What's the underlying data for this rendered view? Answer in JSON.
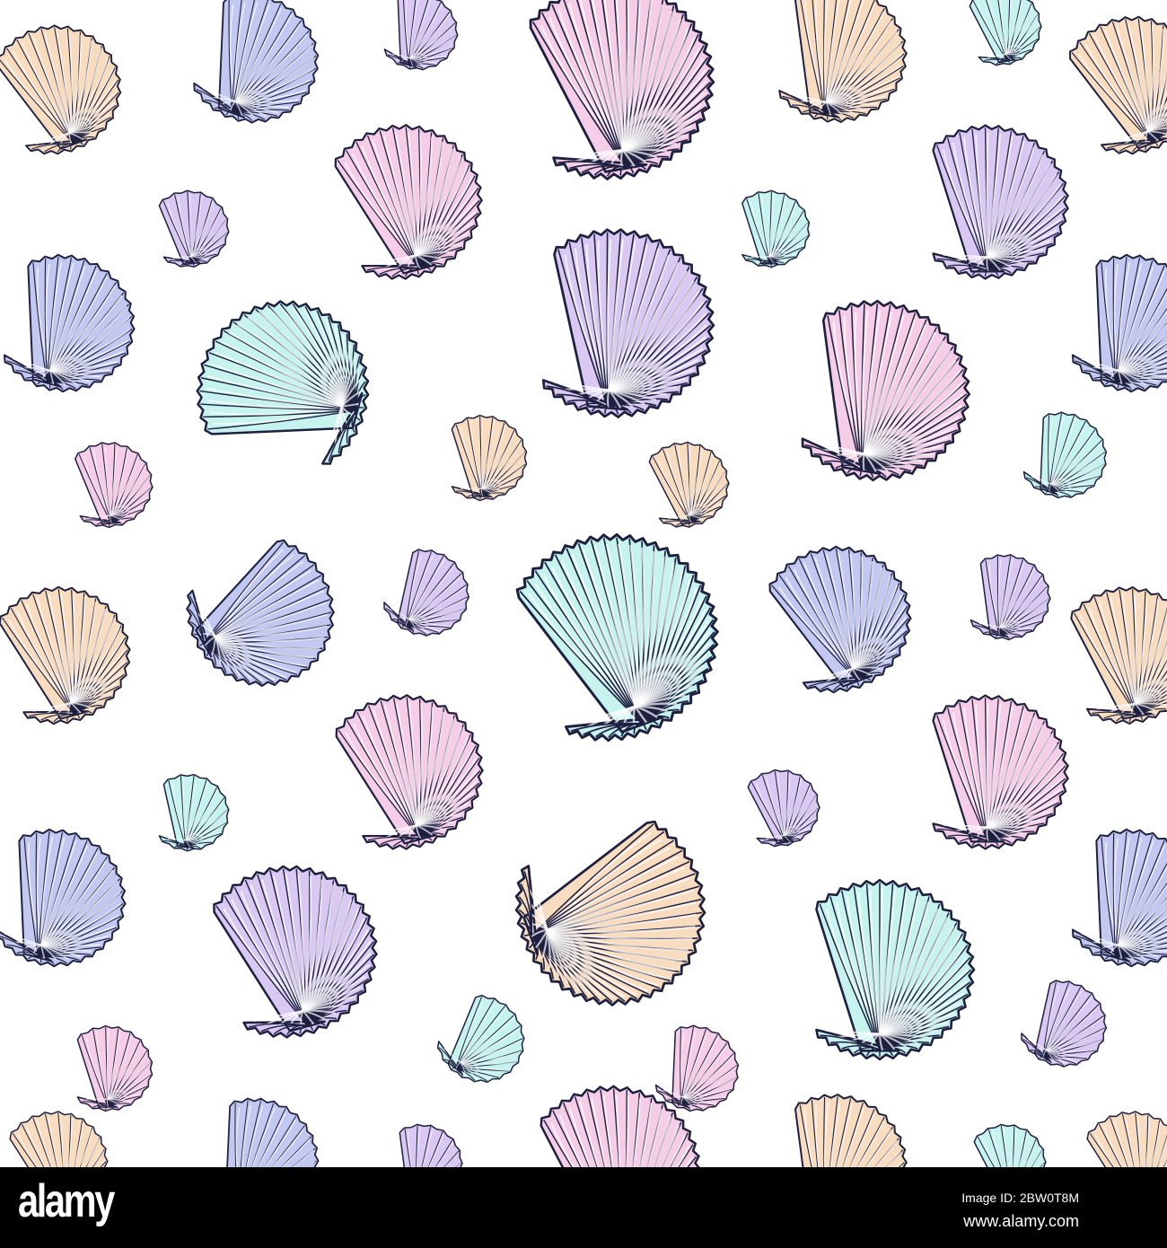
{
  "palette": {
    "outline": "#1e2040",
    "peach": "#f8dcc0",
    "blue": "#c3c8f0",
    "lavender": "#d8c8f2",
    "pink": "#f5cde6",
    "teal": "#c6f3ee"
  },
  "footer": {
    "logo": "alamy",
    "image_id": "Image ID: 2BW0T8M",
    "website": "www.alamy.com"
  }
}
